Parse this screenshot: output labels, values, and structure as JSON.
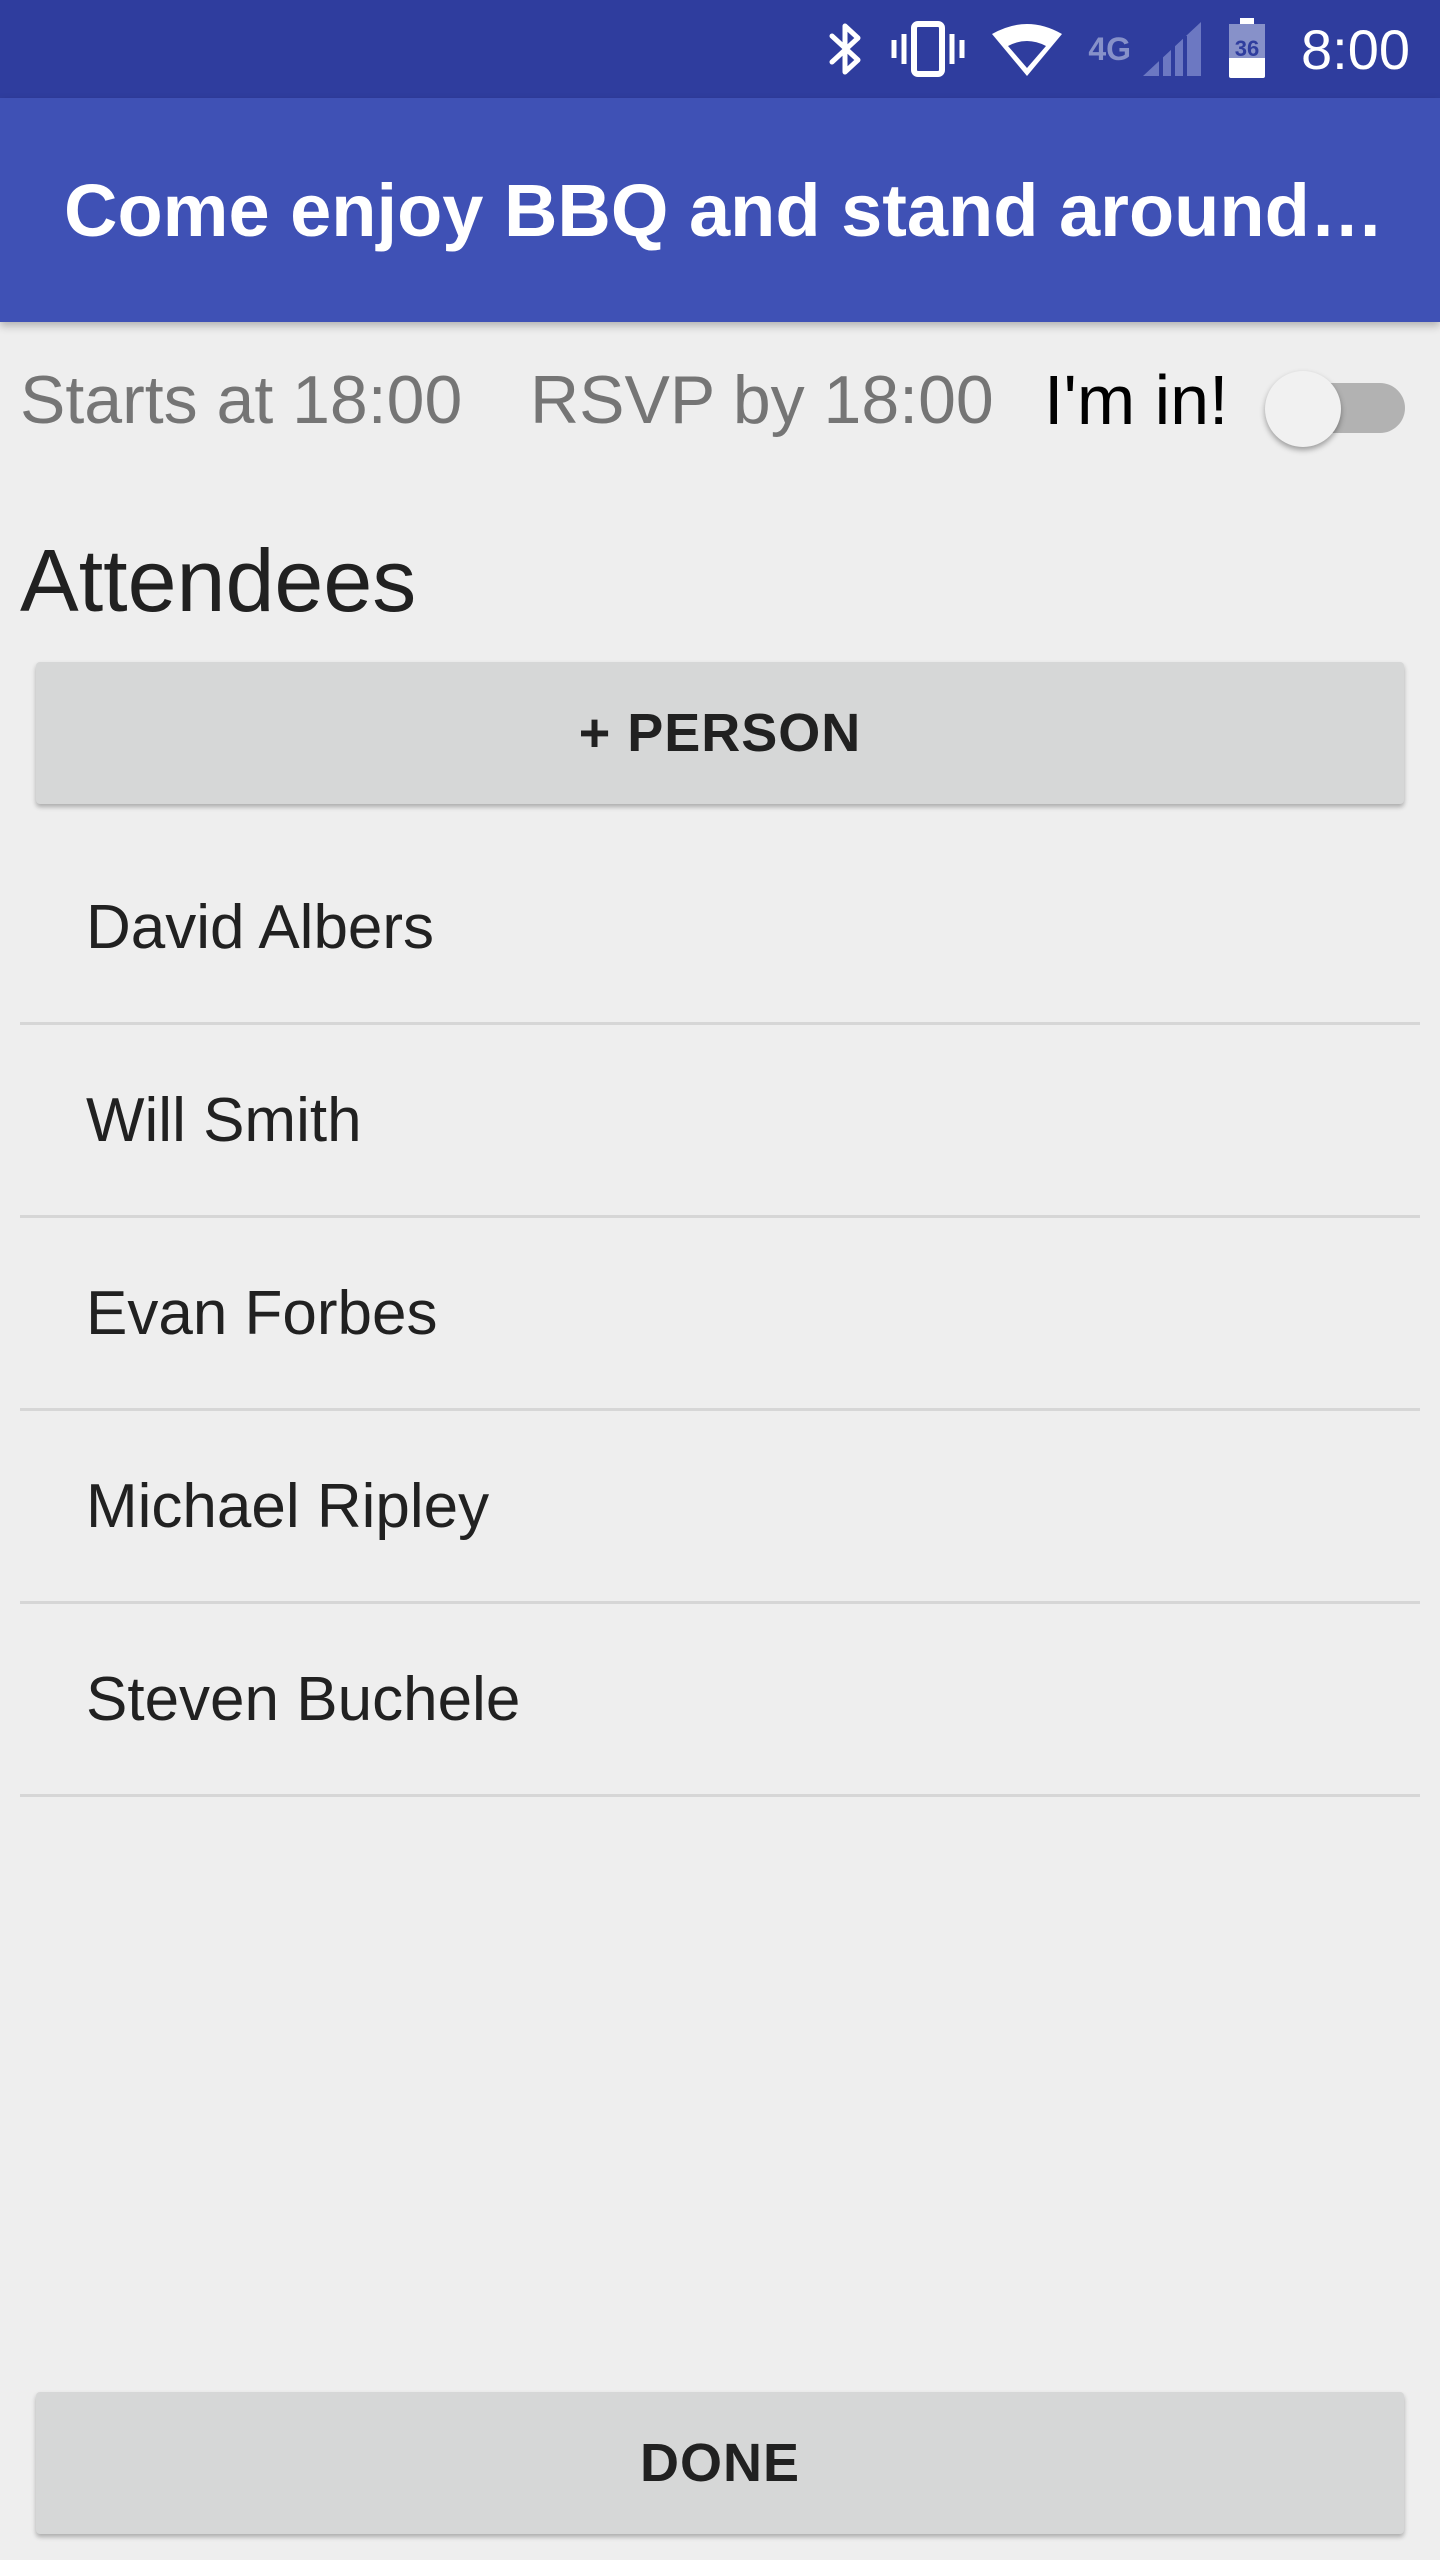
{
  "status_bar": {
    "time": "8:00",
    "network_label": "4G",
    "battery_level": "36",
    "icons": [
      "bluetooth-icon",
      "vibrate-icon",
      "wifi-icon",
      "lte-icon",
      "signal-icon",
      "battery-icon"
    ]
  },
  "app_bar": {
    "title": "Come enjoy BBQ and stand around…",
    "color": "#3f51b5"
  },
  "event": {
    "starts": "Starts at 18:00",
    "rsvp": "RSVP by 18:00",
    "im_in_label": "I'm in!",
    "im_in_checked": false
  },
  "attendees": {
    "heading": "Attendees",
    "add_button_label": "+ PERSON",
    "items": [
      {
        "name": "David Albers"
      },
      {
        "name": "Will Smith"
      },
      {
        "name": "Evan Forbes"
      },
      {
        "name": "Michael Ripley"
      },
      {
        "name": "Steven Buchele"
      }
    ]
  },
  "footer": {
    "done_label": "DONE"
  }
}
